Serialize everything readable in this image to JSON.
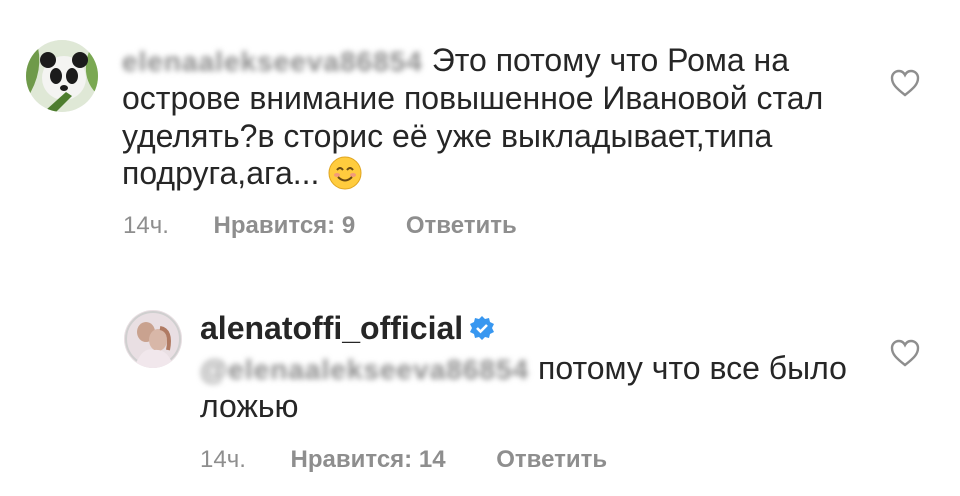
{
  "comments": [
    {
      "username": "elenaalekseeva86854",
      "text": "Это потому что Рома на острове внимание повышенное Ивановой стал уделять?в сторис её уже выкладывает,типа подруга,ага...",
      "emoji_icon": "smiling-face-emoji",
      "time": "14ч.",
      "likes_label": "Нравится: 9",
      "reply_label": "Ответить"
    },
    {
      "username": "alenatoffi_official",
      "verified": true,
      "mention": "@elenaalekseeva86854",
      "text": "потому что все было ложью",
      "time": "14ч.",
      "likes_label": "Нравится: 14",
      "reply_label": "Ответить"
    }
  ],
  "colors": {
    "text": "#262626",
    "meta": "#8e8e8e",
    "verified": "#3897f0"
  }
}
